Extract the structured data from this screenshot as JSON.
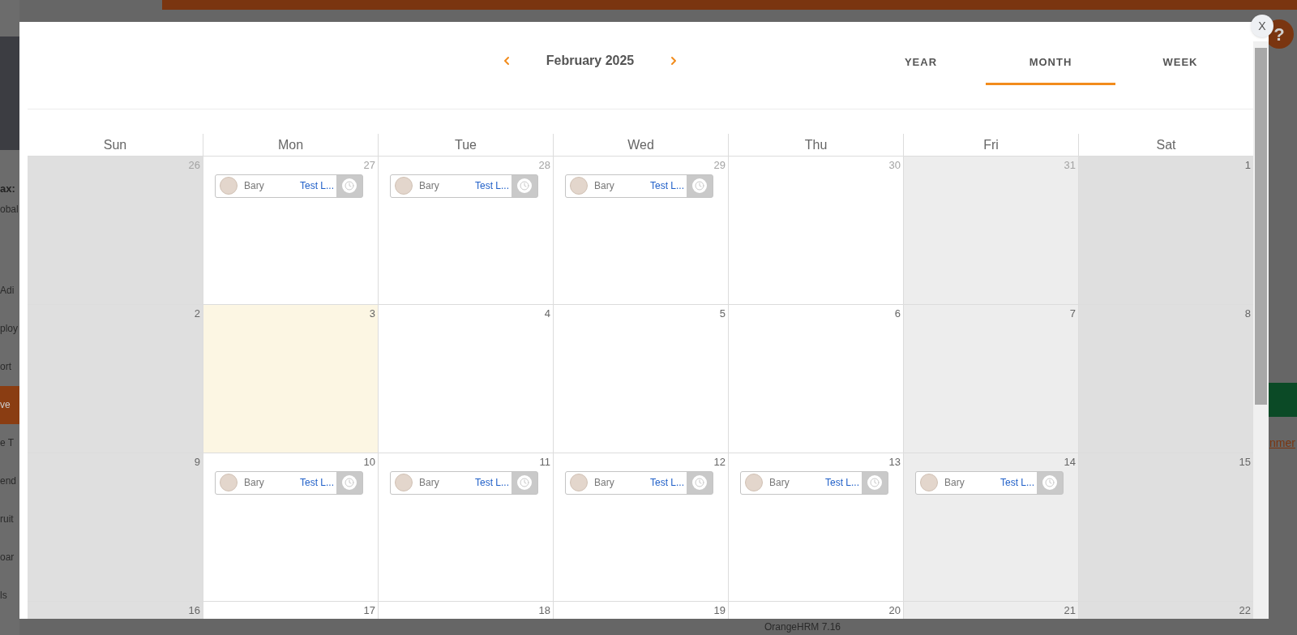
{
  "background": {
    "profile_name": "ax:",
    "profile_subtitle": "obal",
    "sidebar": [
      {
        "label": "Adi",
        "selected": false
      },
      {
        "label": "ploy",
        "selected": false
      },
      {
        "label": "ort",
        "selected": false
      },
      {
        "label": "ve",
        "selected": true
      },
      {
        "label": "e T",
        "selected": false
      },
      {
        "label": "end",
        "selected": false
      },
      {
        "label": "ruit",
        "selected": false
      },
      {
        "label": "oar",
        "selected": false
      },
      {
        "label": "ls",
        "selected": false
      }
    ],
    "help_button": "?",
    "link": "nmer",
    "footer": "OrangeHRM 7.16"
  },
  "calendar_modal": {
    "close": "X",
    "title": "February 2025",
    "tabs": [
      {
        "label": "YEAR",
        "selected": false
      },
      {
        "label": "MONTH",
        "selected": true
      },
      {
        "label": "WEEK",
        "selected": false
      }
    ],
    "weekdays": [
      "Sun",
      "Mon",
      "Tue",
      "Wed",
      "Thu",
      "Fri",
      "Sat"
    ],
    "weeks": [
      {
        "days": [
          {
            "day": "26",
            "outside_month": true,
            "kind": "weekend"
          },
          {
            "day": "27",
            "outside_month": true,
            "kind": "workday",
            "events": [
              {
                "name": "Bary",
                "label": "Test L..."
              }
            ]
          },
          {
            "day": "28",
            "outside_month": true,
            "kind": "workday",
            "events": [
              {
                "name": "Bary",
                "label": "Test L..."
              }
            ]
          },
          {
            "day": "29",
            "outside_month": true,
            "kind": "workday",
            "events": [
              {
                "name": "Bary",
                "label": "Test L..."
              }
            ]
          },
          {
            "day": "30",
            "outside_month": true,
            "kind": "workday"
          },
          {
            "day": "31",
            "outside_month": true,
            "kind": "half-day"
          },
          {
            "day": "1",
            "outside_month": false,
            "kind": "weekend"
          }
        ]
      },
      {
        "days": [
          {
            "day": "2",
            "outside_month": false,
            "kind": "weekend"
          },
          {
            "day": "3",
            "outside_month": false,
            "kind": "today"
          },
          {
            "day": "4",
            "outside_month": false,
            "kind": "workday"
          },
          {
            "day": "5",
            "outside_month": false,
            "kind": "workday"
          },
          {
            "day": "6",
            "outside_month": false,
            "kind": "workday"
          },
          {
            "day": "7",
            "outside_month": false,
            "kind": "half-day"
          },
          {
            "day": "8",
            "outside_month": false,
            "kind": "weekend"
          }
        ]
      },
      {
        "days": [
          {
            "day": "9",
            "outside_month": false,
            "kind": "weekend"
          },
          {
            "day": "10",
            "outside_month": false,
            "kind": "workday",
            "events": [
              {
                "name": "Bary",
                "label": "Test L..."
              }
            ]
          },
          {
            "day": "11",
            "outside_month": false,
            "kind": "workday",
            "events": [
              {
                "name": "Bary",
                "label": "Test L..."
              }
            ]
          },
          {
            "day": "12",
            "outside_month": false,
            "kind": "workday",
            "events": [
              {
                "name": "Bary",
                "label": "Test L..."
              }
            ]
          },
          {
            "day": "13",
            "outside_month": false,
            "kind": "workday",
            "events": [
              {
                "name": "Bary",
                "label": "Test L..."
              }
            ]
          },
          {
            "day": "14",
            "outside_month": false,
            "kind": "half-day",
            "events": [
              {
                "name": "Bary",
                "label": "Test L..."
              }
            ]
          },
          {
            "day": "15",
            "outside_month": false,
            "kind": "weekend"
          }
        ]
      },
      {
        "days": [
          {
            "day": "16",
            "outside_month": false,
            "kind": "weekend"
          },
          {
            "day": "17",
            "outside_month": false,
            "kind": "workday"
          },
          {
            "day": "18",
            "outside_month": false,
            "kind": "workday"
          },
          {
            "day": "19",
            "outside_month": false,
            "kind": "workday"
          },
          {
            "day": "20",
            "outside_month": false,
            "kind": "workday"
          },
          {
            "day": "21",
            "outside_month": false,
            "kind": "half-day"
          },
          {
            "day": "22",
            "outside_month": false,
            "kind": "weekend"
          }
        ]
      }
    ]
  }
}
